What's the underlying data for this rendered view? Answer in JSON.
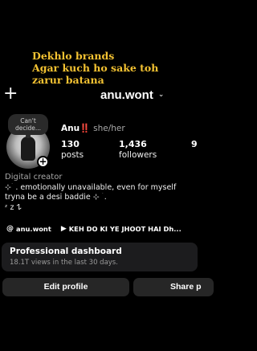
{
  "caption": {
    "lines": [
      "Dekhlo brands",
      "Agar kuch ho sake toh",
      "zarur batana"
    ]
  },
  "header": {
    "username": "anu.wont",
    "chevron_icon": "chevron-down-icon",
    "add_icon": "plus-icon"
  },
  "profile": {
    "note": "Can't decide...",
    "display_name": "Anu",
    "name_emoji": "‼️",
    "pronouns": "she/her",
    "stats": {
      "posts_count": "130",
      "posts_label": "posts",
      "followers_count": "1,436",
      "followers_label": "followers",
      "following_count": "9"
    },
    "bio": {
      "category": "Digital creator",
      "line1": "⊹ ࣪ . emotionally unavailable, even for myself",
      "line2": "tryna be a desi baddie ⊹ ࣪ .",
      "line3": "ᶻ 𝗓 𐰁"
    },
    "links": {
      "threads_handle": "anu.wont",
      "music_track": "KEH DO KI YE JHOOT HAI Dh..."
    }
  },
  "dashboard": {
    "title": "Professional dashboard",
    "subtitle": "18.1T views in the last 30 days."
  },
  "buttons": {
    "edit_profile": "Edit profile",
    "share": "Share p"
  }
}
